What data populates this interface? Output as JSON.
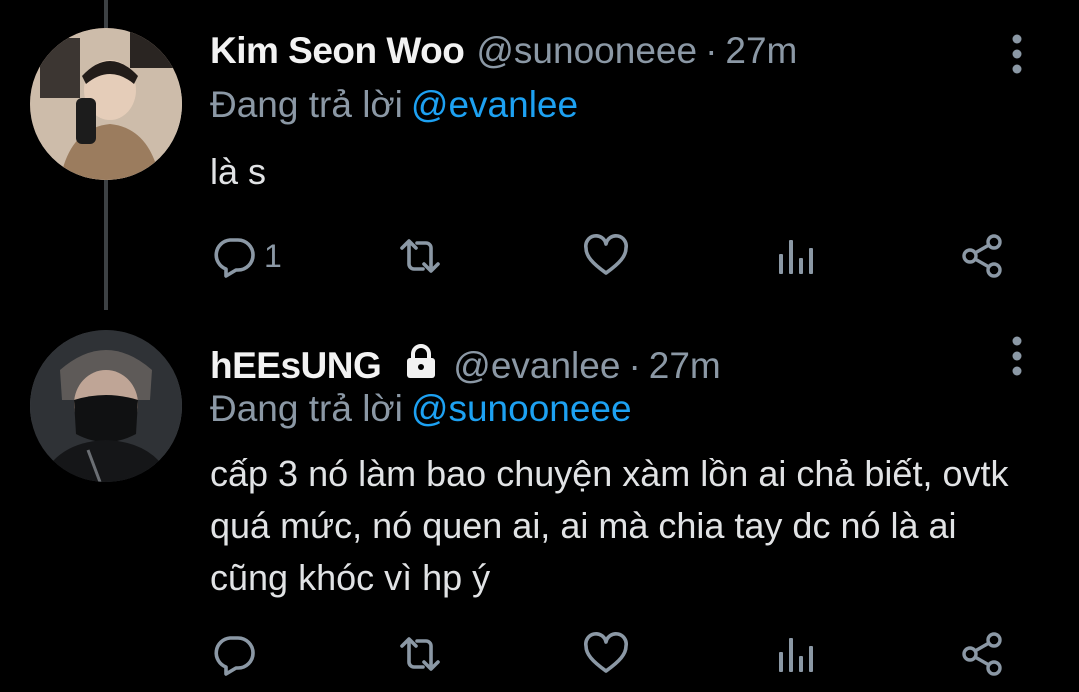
{
  "colors": {
    "background": "#000000",
    "name": "#f2f2f2",
    "secondary": "#8b98a5",
    "mention": "#1da1f2",
    "thread_line": "#3d4144"
  },
  "tweets": [
    {
      "display_name": "Kim Seon Woo",
      "handle": "@sunooneee",
      "separator": "·",
      "time": "27m",
      "reply_prefix": "Đang trả lời",
      "reply_to": "@evanlee",
      "text": "là s",
      "reply_count": "1",
      "protected": false
    },
    {
      "display_name": "hEEsUNG",
      "handle": "@evanlee",
      "separator": "·",
      "time": "27m",
      "reply_prefix": "Đang trả lời",
      "reply_to": "@sunooneee",
      "text": "cấp 3 nó làm bao chuyện xàm lồn ai chả biết, ovtk quá mức, nó quen ai, ai mà chia tay dc nó là ai cũng khóc vì hp ý",
      "reply_count": "",
      "protected": true
    }
  ],
  "icons": [
    "reply-icon",
    "retweet-icon",
    "like-icon",
    "analytics-icon",
    "share-icon",
    "more-options-icon",
    "lock-icon"
  ]
}
